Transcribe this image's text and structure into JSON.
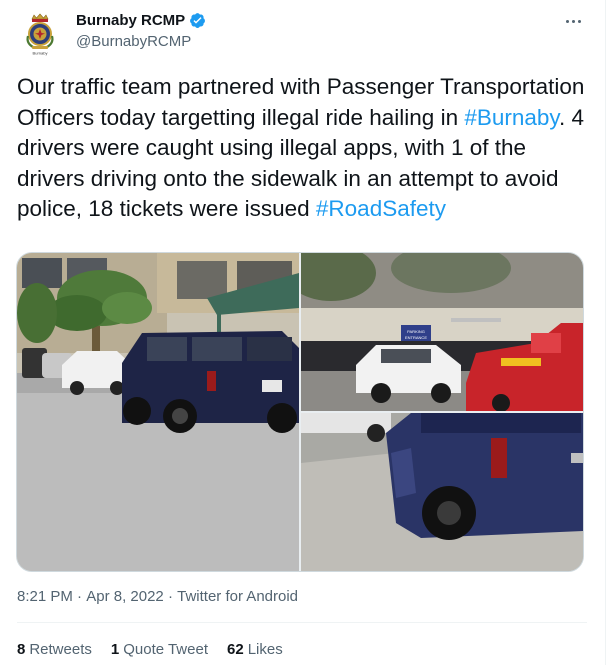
{
  "author": {
    "display_name": "Burnaby RCMP",
    "handle": "@BurnabyRCMP",
    "verified": true,
    "avatar_icon": "rcmp-crest-icon",
    "avatar_caption": "Burnaby"
  },
  "tweet": {
    "text_part1": "Our traffic team partnered with Passenger Transportation Officers today targetting illegal ride hailing in ",
    "hashtag1": "#Burnaby",
    "text_part2": ". 4 drivers were caught using illegal apps, with 1 of the drivers driving onto the sidewalk in an attempt to avoid police, 18 tickets were issued ",
    "hashtag2": "#RoadSafety"
  },
  "media": {
    "photos": [
      "unmarked-police-suv-photo",
      "tow-truck-white-suv-photo",
      "suv-on-sidewalk-photo"
    ],
    "sign_text": [
      "PARKING",
      "ENTRANCE"
    ]
  },
  "meta": {
    "time": "8:21 PM",
    "separator": " · ",
    "date": "Apr 8, 2022",
    "source": "Twitter for Android"
  },
  "stats": {
    "retweets_count": "8",
    "retweets_label": "Retweets",
    "quotes_count": "1",
    "quotes_label": "Quote Tweet",
    "likes_count": "62",
    "likes_label": "Likes"
  },
  "colors": {
    "accent": "#1d9bf0",
    "text": "#0f1419",
    "secondary": "#536471",
    "border": "#eff3f4"
  }
}
